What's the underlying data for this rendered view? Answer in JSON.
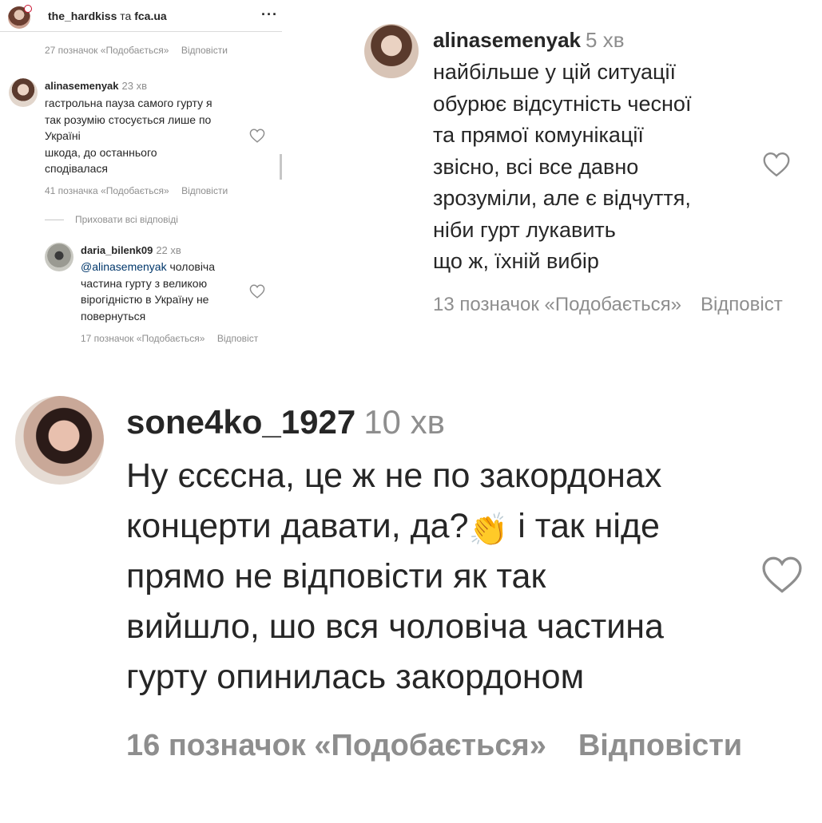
{
  "panel1": {
    "header": {
      "account": "the_hardkiss",
      "connector": "та",
      "collaborator": "fca.ua",
      "more_icon": "more-horizontal-icon"
    },
    "top_meta": {
      "likes": "27 позначок «Подобається»",
      "reply": "Відповісти"
    },
    "comment1": {
      "username": "alinasemenyak",
      "time": "23 хв",
      "lines": [
        "гастрольна пауза самого гурту я",
        "так розумію стосується лише по",
        "Україні",
        "шкода, до останнього",
        "сподівалася"
      ],
      "likes": "41 позначка «Подобається»",
      "reply": "Відповісти"
    },
    "hide_replies": "Приховати всі відповіді",
    "reply1": {
      "username": "daria_bilenk09",
      "time": "22 хв",
      "mention": "@alinasemenyak",
      "line1_rest": " чоловіча",
      "lines": [
        "частина гурту з великою",
        "вірогідністю в Україну не",
        "повернуться"
      ],
      "likes": "17 позначок «Подобається»",
      "reply": "Відповіст"
    }
  },
  "panel2": {
    "username": "alinasemenyak",
    "time": "5 хв",
    "lines": [
      "найбільше у цій ситуації",
      "обурює відсутність чесної",
      "та прямої комунікації",
      "звісно, всі все давно",
      "зрозуміли, але є відчуття,",
      "ніби гурт лукавить",
      "що ж, їхній вибір"
    ],
    "likes": "13 позначок «Подобається»",
    "reply": "Відповіст"
  },
  "panel3": {
    "username": "sone4ko_1927",
    "time": "10 хв",
    "line1": "Ну єсєсна, це ж не по закордонах",
    "line2_before": "концерти давати, да?",
    "emoji": "👏",
    "line2_after": " і так ніде",
    "lines": [
      "прямо не відповісти як так",
      "вийшло, шо вся чоловіча частина",
      "гурту опинилась закордоном"
    ],
    "likes": "16 позначок «Подобається»",
    "reply": "Відповісти"
  },
  "icons": {
    "like": "heart-outline-icon"
  },
  "colors": {
    "text": "#262626",
    "muted": "#8e8e8e",
    "mention": "#00376b",
    "border": "#dbdbdb"
  }
}
